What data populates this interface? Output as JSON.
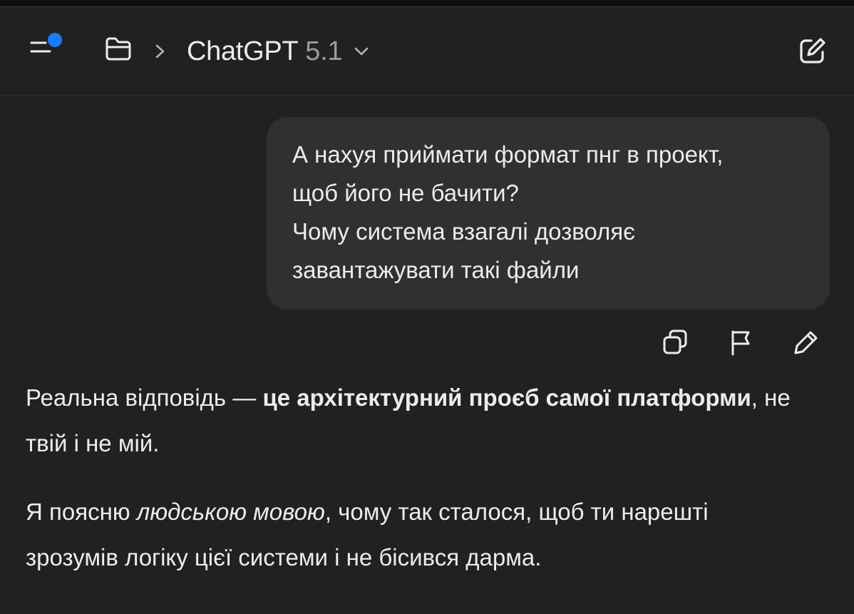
{
  "header": {
    "model_name": "ChatGPT",
    "model_version": "5.1",
    "icons": {
      "menu": "menu-icon",
      "notification_dot": "notification-dot-icon",
      "folder": "folder-icon",
      "breadcrumb_separator": "chevron-right-icon",
      "model_dropdown": "chevron-down-icon",
      "new_chat": "edit-icon"
    },
    "accent_color": "#1a7cff"
  },
  "user_message": {
    "lines": [
      "А нахуя приймати формат пнг в проект,",
      "щоб його не бачити?",
      "Чому система взагалі дозволяє",
      "завантажувати такі файли"
    ],
    "actions": [
      {
        "name": "copy",
        "icon": "copy-icon"
      },
      {
        "name": "report",
        "icon": "flag-icon"
      },
      {
        "name": "edit",
        "icon": "pencil-icon"
      }
    ]
  },
  "assistant_message": {
    "p1": {
      "prefix": "Реальна відповідь — ",
      "bold": "це архітектурний проєб самої платформи",
      "suffix": ", не",
      "line2": "твій і не мій."
    },
    "p2": {
      "prefix": "Я поясню ",
      "italic": "людською мовою",
      "suffix": ", чому так сталося, щоб ти нарешті",
      "line2": "зрозумів логіку цієї системи і не бісився дарма."
    }
  }
}
